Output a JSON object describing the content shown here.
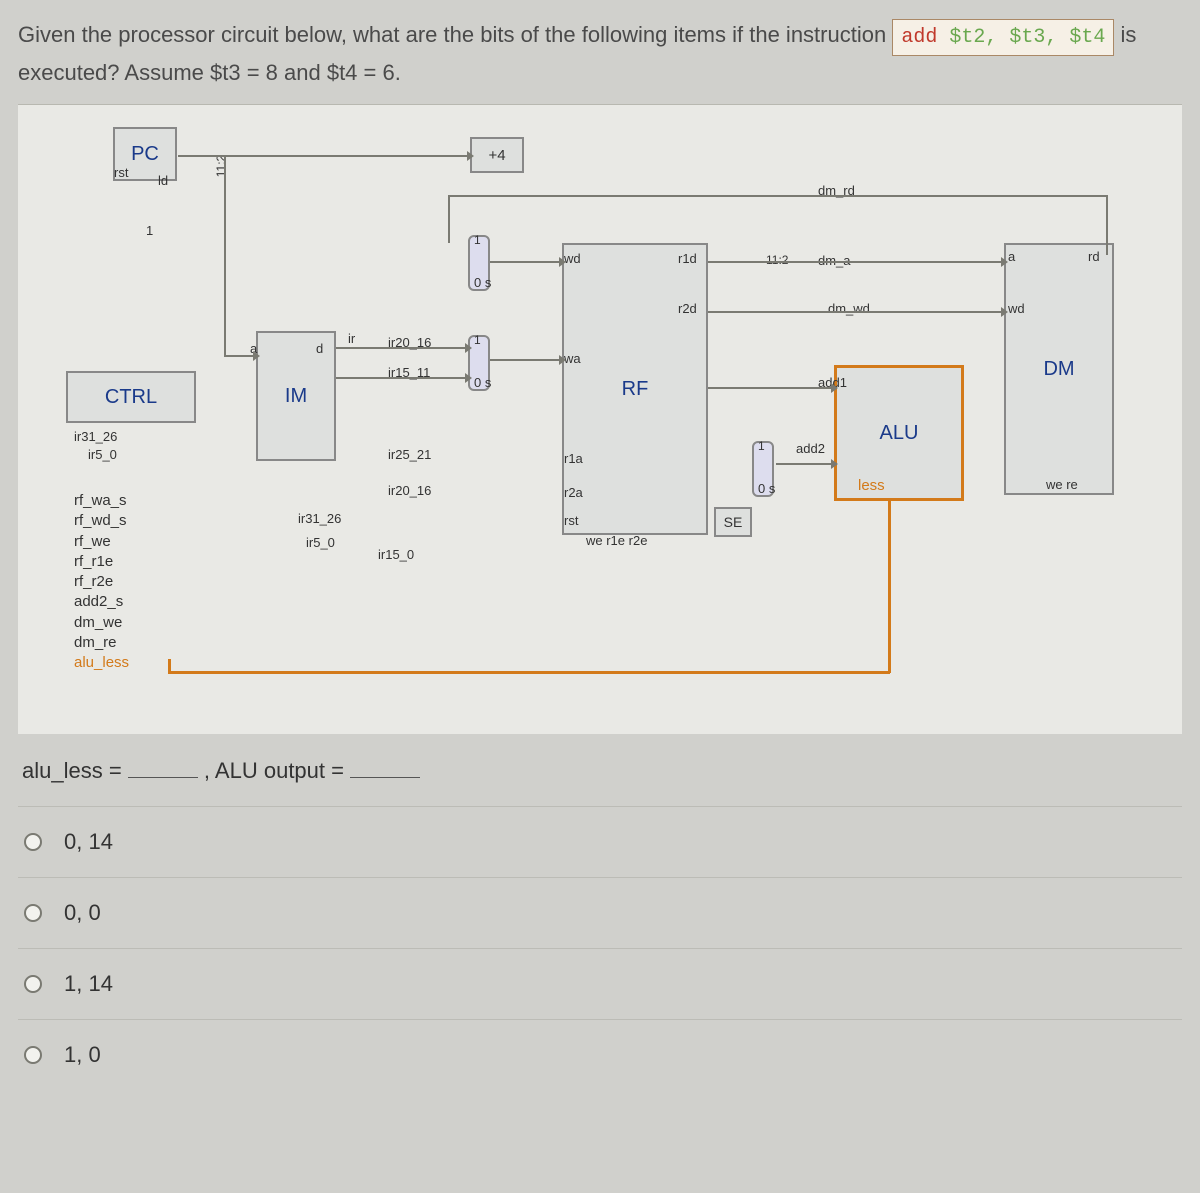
{
  "question": {
    "lead": "Given the processor circuit below, what are the bits of the following items if the instruction",
    "code_kw": "add",
    "code_regs": " $t2, $t3, $t4",
    "tail": " is executed? Assume $t3 = 8 and $t4 = 6."
  },
  "diagram": {
    "pc": "PC",
    "rst": "rst",
    "ld": "ld",
    "plus4": "+4",
    "one": "1",
    "wd": "wd",
    "wa": "wa",
    "r1d": "r1d",
    "r2d": "r2d",
    "r1a": "r1a",
    "r2a": "r2a",
    "a": "a",
    "d": "d",
    "ir": "ir",
    "ctrl": "CTRL",
    "im": "IM",
    "rf": "RF",
    "alu": "ALU",
    "dm": "DM",
    "se": "SE",
    "dm_rd": "dm_rd",
    "dm_a": "dm_a",
    "dm_wd": "dm_wd",
    "add1": "add1",
    "add2": "add2",
    "less": "less",
    "a_rd": "a",
    "rd": "rd",
    "wd2": "wd",
    "we_re": "we re",
    "we_r1e_r2e": "we r1e r2e",
    "rst2": "rst",
    "eleven2": "11:2",
    "eleven2b": "11:2",
    "zero_s": "0 s",
    "zero_s2": "0 s",
    "zero_s3": "0 s",
    "one_sel": "1",
    "one_sel2": "1",
    "ir20_16": "ir20_16",
    "ir15_11": "ir15_11",
    "ir25_21": "ir25_21",
    "ir20_16b": "ir20_16",
    "ir31_26": "ir31_26",
    "ir5_0": "ir5_0",
    "ir15_0": "ir15_0",
    "ctrl_31_26": "ir31_26",
    "ctrl_5_0": "ir5_0",
    "ctrl_list": [
      "rf_wa_s",
      "rf_wd_s",
      "rf_we",
      "rf_r1e",
      "rf_r2e",
      "add2_s",
      "dm_we",
      "dm_re"
    ],
    "alu_less_sig": "alu_less"
  },
  "fill": {
    "prefix": "alu_less = ",
    "mid": ", ALU output = "
  },
  "options": [
    "0, 14",
    "0, 0",
    "1, 14",
    "1, 0"
  ]
}
